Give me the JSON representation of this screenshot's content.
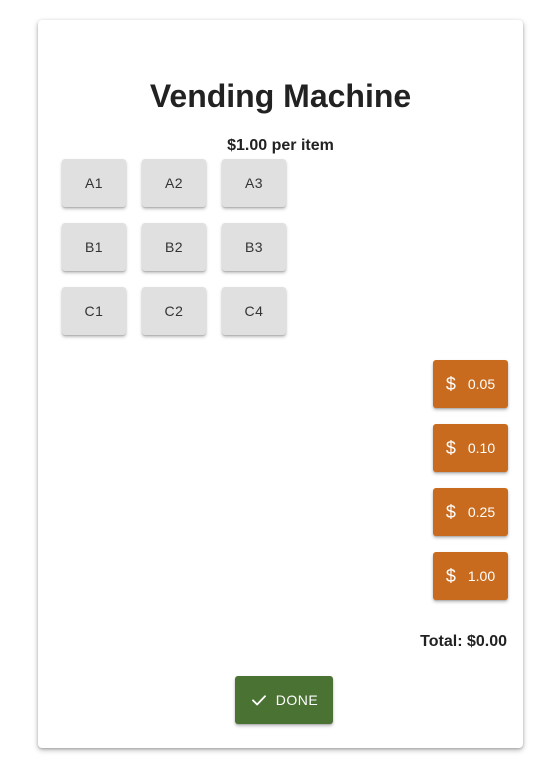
{
  "header": {
    "title": "Vending Machine",
    "price_text": "$1.00 per item"
  },
  "items": [
    {
      "label": "A1"
    },
    {
      "label": "A2"
    },
    {
      "label": "A3"
    },
    {
      "label": "B1"
    },
    {
      "label": "B2"
    },
    {
      "label": "B3"
    },
    {
      "label": "C1"
    },
    {
      "label": "C2"
    },
    {
      "label": "C4"
    }
  ],
  "coins": [
    {
      "icon": "dollar-icon",
      "symbol": "$",
      "label": "0.05"
    },
    {
      "icon": "dollar-icon",
      "symbol": "$",
      "label": "0.10"
    },
    {
      "icon": "dollar-icon",
      "symbol": "$",
      "label": "0.25"
    },
    {
      "icon": "dollar-icon",
      "symbol": "$",
      "label": "1.00"
    }
  ],
  "total_text": "Total: $0.00",
  "done_button": {
    "icon": "check-icon",
    "label": "DONE"
  },
  "colors": {
    "coin_button": "#c96b1f",
    "done_button": "#4a7233",
    "item_button": "#e0e0e0"
  }
}
